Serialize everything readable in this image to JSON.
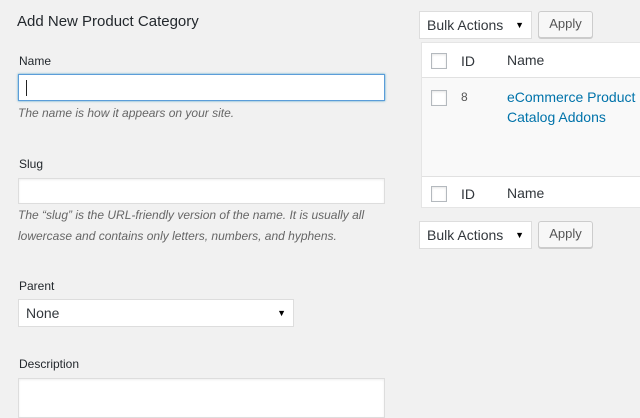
{
  "form": {
    "title": "Add New Product Category",
    "name_label": "Name",
    "name_value": "",
    "name_help": "The name is how it appears on your site.",
    "slug_label": "Slug",
    "slug_value": "",
    "slug_help_line1": "The “slug” is the URL-friendly version of the name. It is usually all",
    "slug_help_line2": "lowercase and contains only letters, numbers, and hyphens.",
    "parent_label": "Parent",
    "parent_selected": "None",
    "description_label": "Description"
  },
  "bulk_top": {
    "selected": "Bulk Actions",
    "apply_label": "Apply"
  },
  "bulk_bottom": {
    "selected": "Bulk Actions",
    "apply_label": "Apply"
  },
  "table": {
    "columns": [
      "ID",
      "Name"
    ],
    "rows": [
      {
        "id": "8",
        "name_line1": "eCommerce Product",
        "name_line2": "Catalog Addons"
      }
    ],
    "footer": [
      "ID",
      "Name"
    ]
  },
  "icons": {
    "dropdown": "dropdown-arrow-icon"
  },
  "colors": {
    "link": "#0073aa",
    "focus_border": "#5b9dd9",
    "background": "#f1f1f1"
  }
}
